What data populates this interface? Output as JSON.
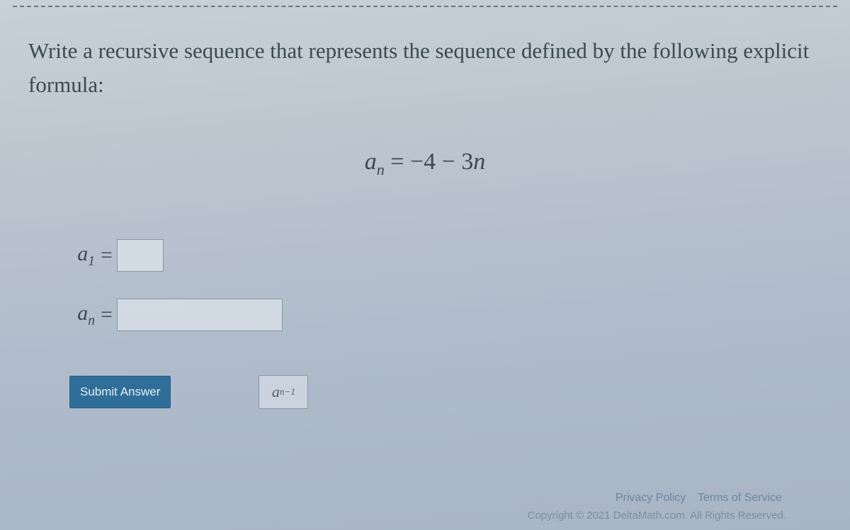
{
  "prompt": "Write a recursive sequence that represents the sequence defined by the following explicit formula:",
  "formula": {
    "lhs_var": "a",
    "lhs_sub": "n",
    "rhs": "= −4 − 3n",
    "rhs_var": "n"
  },
  "inputs": {
    "a1": {
      "var": "a",
      "sub": "1",
      "eq": "=",
      "value": ""
    },
    "an": {
      "var": "a",
      "sub": "n",
      "eq": "=",
      "value": ""
    }
  },
  "buttons": {
    "submit": "Submit Answer",
    "helper_var": "a",
    "helper_sub": "n−1"
  },
  "footer": {
    "privacy": "Privacy Policy",
    "terms": "Terms of Service",
    "copyright": "Copyright © 2021 DeltaMath.com. All Rights Reserved."
  }
}
